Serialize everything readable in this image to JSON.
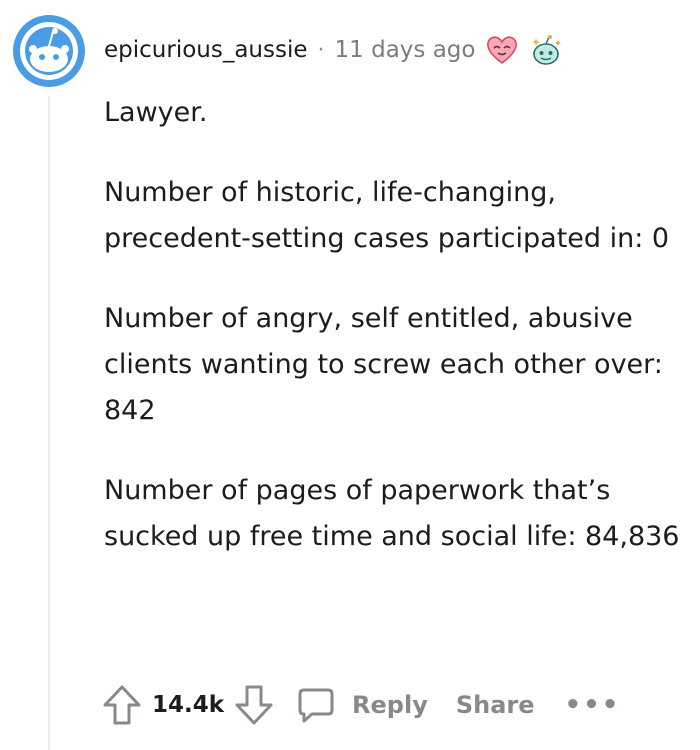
{
  "comment": {
    "author": "epicurious_aussie",
    "separator": "·",
    "time": "11 days ago",
    "awards": [
      "heart-eyes-award-icon",
      "snoo-sparkle-award-icon"
    ],
    "paragraphs": [
      "Lawyer.",
      "Number of historic, life-changing, precedent-setting cases participated in: 0",
      "Number of angry, self entitled, abusive clients wanting to screw each other over: 842",
      "Number of pages of paperwork that’s sucked up free time and social life: 84,836"
    ]
  },
  "actions": {
    "score": "14.4k",
    "reply_label": "Reply",
    "share_label": "Share",
    "more_label": "•••"
  },
  "colors": {
    "avatar_blue": "#4a9de4",
    "muted_text": "#878a8c",
    "text": "#1c1c1c",
    "thread_line": "#edeff1"
  }
}
